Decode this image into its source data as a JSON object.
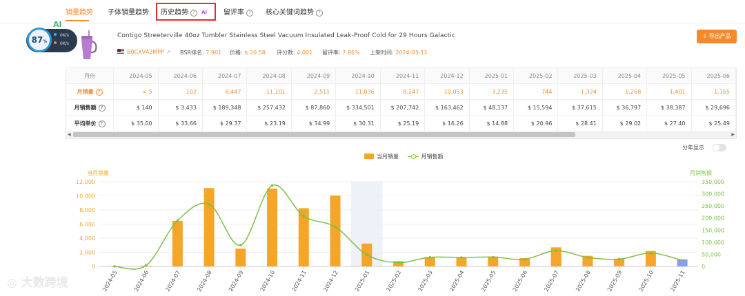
{
  "tabs": [
    {
      "label": "销量趋势",
      "active": true,
      "help": false
    },
    {
      "label": "子体销量趋势",
      "active": false,
      "help": false
    },
    {
      "label": "历史趋势",
      "active": false,
      "help": true,
      "badge": "AI"
    },
    {
      "label": "留评率",
      "active": false,
      "help": true
    },
    {
      "label": "核心关键词趋势",
      "active": false,
      "help": true
    }
  ],
  "score": {
    "value": "87",
    "unit": "%",
    "ai_label": "AI",
    "up_speed": "0K/s",
    "down_speed": "0K/s"
  },
  "product": {
    "title": "Contigo Streeterville 40oz Tumbler Stainless Steel Vacuum Insulated Leak-Proof Cold for 29 Hours Galactic",
    "asin": "B0CXV42MPP",
    "bsr_label": "BSR排名:",
    "bsr": "7,901",
    "price_label": "价格:",
    "price": "$ 20.58",
    "reviews_label": "评分数:",
    "reviews": "4,001",
    "review_rate_label": "留评率:",
    "review_rate": "7.86%",
    "listed_label": "上架时间:",
    "listed": "2024-03-11"
  },
  "export_label": "导出产品",
  "table": {
    "header_label": "月份",
    "months": [
      "2024-05",
      "2024-06",
      "2024-07",
      "2024-08",
      "2024-09",
      "2024-10",
      "2024-11",
      "2024-12",
      "2025-01",
      "2025-02",
      "2025-03",
      "2025-04",
      "2025-05",
      "2025-06"
    ],
    "rows": [
      {
        "label": "月销量",
        "values": [
          "< 5",
          "102",
          "6,447",
          "11,101",
          "2,511",
          "11,036",
          "8,247",
          "10,053",
          "3,235",
          "744",
          "1,324",
          "1,268",
          "1,401",
          "1,165"
        ]
      },
      {
        "label": "月销售额",
        "values": [
          "$ 140",
          "$ 3,433",
          "$ 189,348",
          "$ 257,432",
          "$ 87,860",
          "$ 334,501",
          "$ 207,742",
          "$ 163,462",
          "$ 48,137",
          "$ 15,594",
          "$ 37,615",
          "$ 36,797",
          "$ 38,387",
          "$ 29,696"
        ]
      },
      {
        "label": "平均单价",
        "values": [
          "$ 35.00",
          "$ 33.66",
          "$ 29.37",
          "$ 23.19",
          "$ 34.99",
          "$ 30.31",
          "$ 25.19",
          "$ 16.26",
          "$ 14.88",
          "$ 20.96",
          "$ 28.41",
          "$ 29.02",
          "$ 27.40",
          "$ 25.49"
        ]
      }
    ]
  },
  "chart_controls": {
    "toggle_label": "分年显示",
    "toggle_on": false
  },
  "chart_data": {
    "type": "bar",
    "categories": [
      "2024-05",
      "2024-06",
      "2024-07",
      "2024-08",
      "2024-09",
      "2024-10",
      "2024-11",
      "2024-12",
      "2025-01",
      "2025-02",
      "2025-03",
      "2025-04",
      "2025-05",
      "2025-06",
      "2025-07",
      "2025-08",
      "2025-09",
      "2025-10",
      "2025-11"
    ],
    "series": [
      {
        "name": "当月销量",
        "type": "bar",
        "axis": "left",
        "color": "#f5a62a",
        "values": [
          5,
          102,
          6447,
          11101,
          2511,
          11036,
          8247,
          10053,
          3235,
          744,
          1324,
          1268,
          1401,
          1165,
          2700,
          1500,
          1100,
          2200,
          1000
        ]
      },
      {
        "name": "月销售额",
        "type": "line",
        "axis": "right",
        "color": "#7cc13f",
        "values": [
          140,
          3433,
          189348,
          257432,
          87860,
          334501,
          207742,
          163462,
          48137,
          15594,
          37615,
          36797,
          38387,
          29696,
          65000,
          37000,
          30000,
          55000,
          25000
        ]
      }
    ],
    "ylabel_left": "当月销量",
    "ylabel_right": "月销售额",
    "ylim_left": [
      0,
      12000
    ],
    "ylim_right": [
      0,
      350000
    ],
    "yticks_left": [
      "0",
      "2,000",
      "4,000",
      "6,000",
      "8,000",
      "10,000",
      "12,000"
    ],
    "yticks_right": [
      "0",
      "50,000",
      "100,000",
      "150,000",
      "200,000",
      "250,000",
      "300,000",
      "350,000"
    ],
    "highlight_category": "2025-01",
    "current_bar_color": "#8c9cf0",
    "grid": true,
    "legend": "top-center"
  },
  "watermark": "大数跨境"
}
